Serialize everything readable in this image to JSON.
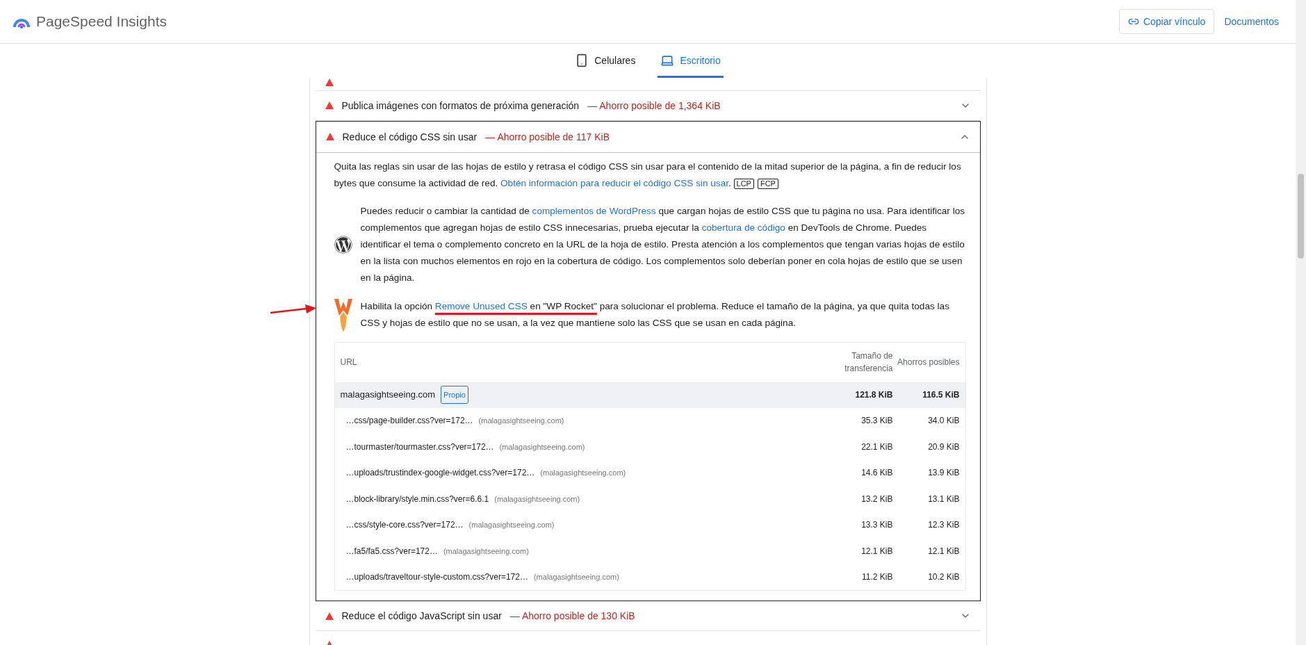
{
  "header": {
    "logo_text": "PageSpeed Insights",
    "buttons": [
      {
        "label": "Copiar vínculo",
        "kind": "outlined"
      },
      {
        "label": "Documentos",
        "kind": "text"
      }
    ]
  },
  "device_tabs": [
    {
      "label": "Celulares",
      "kind": "phone",
      "selected": false
    },
    {
      "label": "Escritorio",
      "kind": "desktop",
      "selected": true
    }
  ],
  "audits": [
    {
      "kind": "clipped_top"
    },
    {
      "kind": "row",
      "title": "Publica imágenes con formatos de próxima generación",
      "savings": "— Ahorro posible de 1,364 KiB",
      "expanded": false
    },
    {
      "kind": "row",
      "title": "Reduce el código CSS sin usar",
      "savings": "— Ahorro posible de 117 KiB",
      "expanded": true,
      "description": [
        {
          "kind": "text",
          "text": "Quita las reglas sin usar de las hojas de estilo y retrasa el código CSS sin usar para el contenido de la mitad superior de la página, a fin de reducir los bytes que consume la actividad de red. "
        },
        {
          "kind": "link",
          "text": "Obtén información para reducir el código CSS sin usar"
        },
        {
          "kind": "text",
          "text": ". "
        },
        {
          "kind": "badge",
          "text": "LCP"
        },
        {
          "kind": "badge",
          "text": "FCP"
        }
      ],
      "stack_packs": [
        {
          "kind": "wordpress",
          "segments": [
            {
              "kind": "text",
              "text": "Puedes reducir o cambiar la cantidad de "
            },
            {
              "kind": "link",
              "text": "complementos de WordPress"
            },
            {
              "kind": "text",
              "text": " que cargan hojas de estilo CSS que tu página no usa. Para identificar los complementos que agregan hojas de estilo CSS innecesarias, prueba ejecutar la "
            },
            {
              "kind": "link",
              "text": "cobertura de código"
            },
            {
              "kind": "text",
              "text": " en DevTools de Chrome. Puedes identificar el tema o complemento concreto en la URL de la hoja de estilo. Presta atención a los complementos que tengan varias hojas de estilo en la lista con muchos elementos en rojo en la cobertura de código. Los complementos solo deberían poner en cola hojas de estilo que se usen en la página."
            }
          ]
        },
        {
          "kind": "wp_rocket",
          "pointer_arrow": true,
          "segments": [
            {
              "kind": "text",
              "text": "Habilita la opción "
            },
            {
              "kind": "link",
              "text": "Remove Unused CSS",
              "highlighted": true
            },
            {
              "kind": "text",
              "text": " en \"WP Rocket\"",
              "highlighted": true
            },
            {
              "kind": "text",
              "text": " para solucionar el problema. Reduce el tamaño de la página, ya que quita todas las CSS y hojas de estilo que no se usan, a la vez que mantiene solo las CSS que se usan en cada página."
            }
          ]
        }
      ],
      "table": {
        "columns": [
          "URL",
          "Tamaño de transferencia",
          "Ahorros posibles"
        ],
        "group": {
          "entity": "malagasightseeing.com",
          "badge": "Propio",
          "transfer": "121.8 KiB",
          "savings": "116.5 KiB"
        },
        "rows": [
          {
            "url": "…css/page-builder.css?ver=172…",
            "host": "(malagasightseeing.com)",
            "transfer": "35.3 KiB",
            "savings": "34.0 KiB"
          },
          {
            "url": "…tourmaster/tourmaster.css?ver=172…",
            "host": "(malagasightseeing.com)",
            "transfer": "22.1 KiB",
            "savings": "20.9 KiB"
          },
          {
            "url": "…uploads/trustindex-google-widget.css?ver=172…",
            "host": "(malagasightseeing.com)",
            "transfer": "14.6 KiB",
            "savings": "13.9 KiB"
          },
          {
            "url": "…block-library/style.min.css?ver=6.6.1",
            "host": "(malagasightseeing.com)",
            "transfer": "13.2 KiB",
            "savings": "13.1 KiB"
          },
          {
            "url": "…css/style-core.css?ver=172…",
            "host": "(malagasightseeing.com)",
            "transfer": "13.3 KiB",
            "savings": "12.3 KiB"
          },
          {
            "url": "…fa5/fa5.css?ver=172…",
            "host": "(malagasightseeing.com)",
            "transfer": "12.1 KiB",
            "savings": "12.1 KiB"
          },
          {
            "url": "…uploads/traveltour-style-custom.css?ver=172…",
            "host": "(malagasightseeing.com)",
            "transfer": "11.2 KiB",
            "savings": "10.2 KiB"
          }
        ]
      }
    },
    {
      "kind": "row",
      "title": "Reduce el código JavaScript sin usar",
      "savings": "— Ahorro posible de 130 KiB",
      "expanded": false
    },
    {
      "kind": "clipped_bottom"
    }
  ]
}
